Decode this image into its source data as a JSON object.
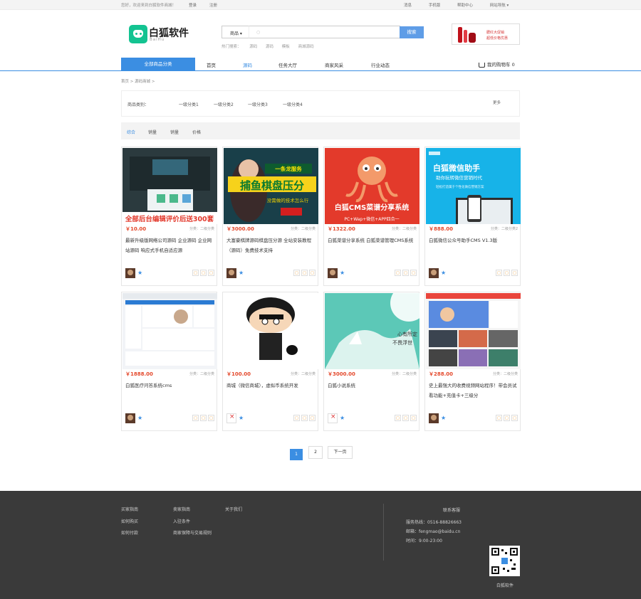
{
  "topbar": {
    "welcome": "您好，欢迎来到白狐软件商城！",
    "login": "登录",
    "register": "注册",
    "links": [
      "消息",
      "手机版",
      "帮助中心",
      "网站导航 ▾"
    ]
  },
  "brand": {
    "name_cn": "白狐软件",
    "name_en": "BaiHu"
  },
  "search": {
    "category": "商品",
    "button": "搜索",
    "hot_label": "热门搜索：",
    "hot": [
      "源码",
      "源码",
      "模板",
      "商城源码"
    ]
  },
  "ad": {
    "line1": "腮红大促销",
    "line2": "超低价格优惠"
  },
  "nav": {
    "all": "全部商品分类",
    "items": [
      "首页",
      "源码",
      "任务大厅",
      "商家风采",
      "行业动态"
    ],
    "cart": "我的购物车 0"
  },
  "crumb": "首页 > 源码商城 >",
  "filter": {
    "label": "商品类别：",
    "items": [
      "一级分类1",
      "一级分类2",
      "一级分类3",
      "一级分类4"
    ],
    "more": "更多"
  },
  "sort": [
    "综合",
    "销量",
    "销量",
    "价格"
  ],
  "products": [
    {
      "price": "￥10.00",
      "cat": "分类：二级分类",
      "title": "最新升级版网络公司源码 企业源码 企业网站源码 响应式手机自适应源",
      "banner": "全部后台编辑评价后送300套"
    },
    {
      "price": "￥3000.00",
      "cat": "分类：二级分类",
      "title": "大富豪棋牌源码棋盘压分源 全站安装教程（源码）免费技术支持",
      "banner": "捕鱼棋盘压分"
    },
    {
      "price": "￥1322.00",
      "cat": "分类：二级分类",
      "title": "白狐菜谱分享系统 白狐菜谱管理CMS系统",
      "banner": "白狐CMS菜谱分享系统"
    },
    {
      "price": "￥888.00",
      "cat": "分类：二级分类2",
      "title": "白狐微信公众号助手CMS V1.3版",
      "banner": "白狐微信助手"
    },
    {
      "price": "￥1888.00",
      "cat": "分类：二级分类",
      "title": "白狐医疗问答系统cms",
      "banner": ""
    },
    {
      "price": "￥100.00",
      "cat": "分类：二级分类",
      "title": "商城（微信商城），虚拟币系统开发",
      "banner": ""
    },
    {
      "price": "￥3000.00",
      "cat": "分类：二级分类",
      "title": "白狐小说系统",
      "banner": ""
    },
    {
      "price": "￥288.00",
      "cat": "分类：二级分类",
      "title": "史上最强大的收费视频网站程序！带会员试看功能+充值卡+三级分",
      "banner": ""
    }
  ],
  "pager": {
    "pages": [
      "1",
      "2"
    ],
    "next": "下一页"
  },
  "footer": {
    "col1": [
      "买家指南",
      "如何购买",
      "如何付款"
    ],
    "col2": [
      "卖家指南",
      "入驻条件",
      "商家保障与交易规则"
    ],
    "col3": [
      "关于我们"
    ],
    "contact_title": "联系客服",
    "phone": "服务热线：0516-88826663",
    "email": "邮箱：fengmao@baidu.cn",
    "hours": "时间：9:00-23:00",
    "qr_label": "白狐软件"
  }
}
